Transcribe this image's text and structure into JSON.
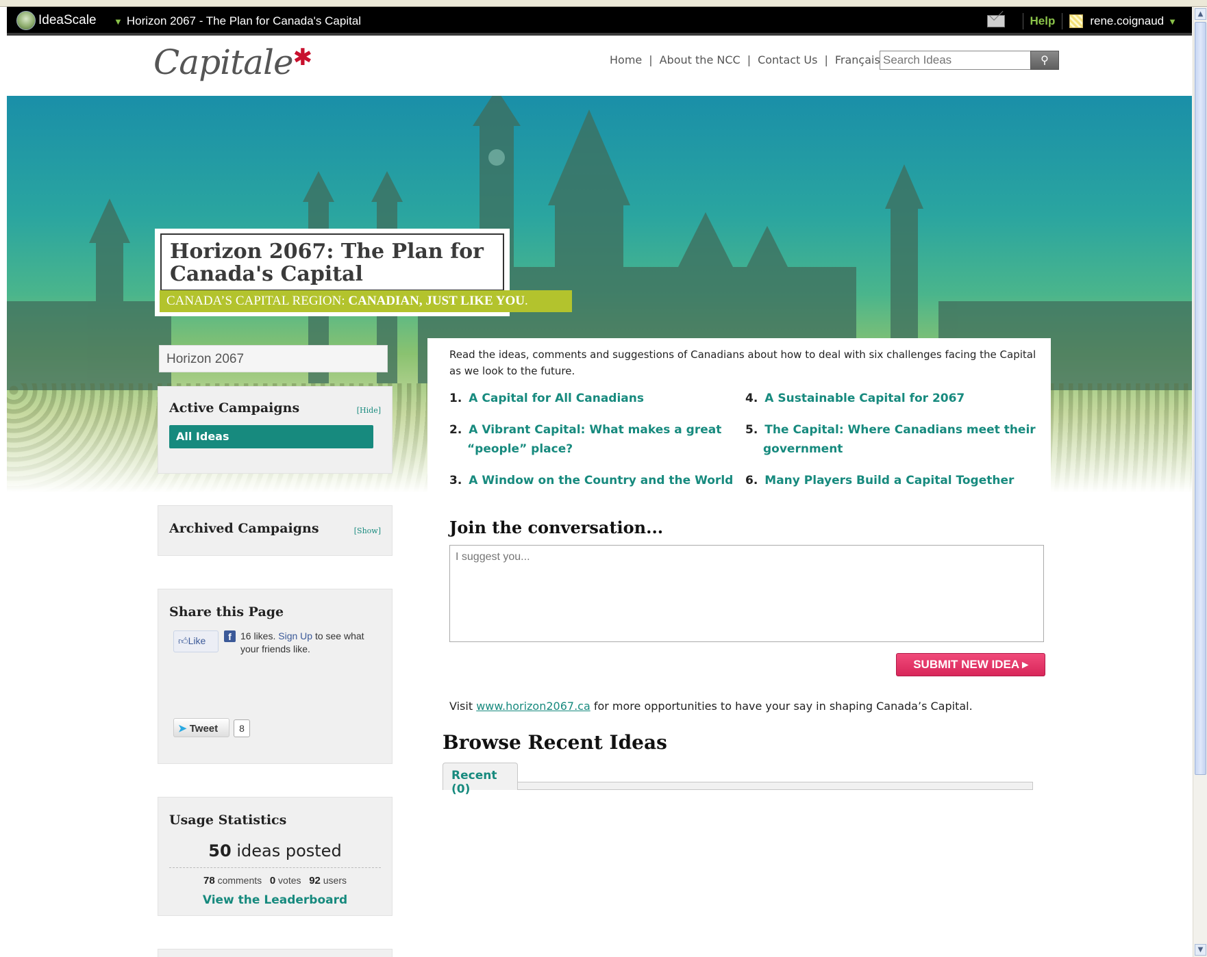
{
  "ideascale_bar": {
    "logo_text": "IdeaScale",
    "campaign_title": "Horizon 2067 - The Plan for Canada's Capital",
    "help_label": "Help",
    "username": "rene.coignaud",
    "dropdown_arrow": "▼"
  },
  "header": {
    "brand_text": "Capitale",
    "nav": [
      "Home",
      "About the NCC",
      "Contact Us",
      "Français"
    ],
    "nav_separator": "|",
    "search_placeholder": "Search Ideas"
  },
  "hero": {
    "title": "Horizon 2067: The Plan for Canada's Capital",
    "tagline_regular": "CANADA’S CAPITAL REGION: ",
    "tagline_bold": "CANADIAN, JUST LIKE YOU",
    "tagline_end": "."
  },
  "sidebar": {
    "breadcrumb": "Horizon 2067",
    "active": {
      "heading": "Active Campaigns",
      "toggle": "[Hide]",
      "item": "All Ideas"
    },
    "archived": {
      "heading": "Archived Campaigns",
      "toggle": "[Show]"
    },
    "share": {
      "heading": "Share this Page",
      "like_label": "Like",
      "likes_count_text": "16 likes.",
      "sign_up": "Sign Up",
      "like_rest": "to see what your friends like.",
      "tweet_label": "Tweet",
      "tweet_count": "8"
    },
    "stats": {
      "heading": "Usage Statistics",
      "ideas_count": "50",
      "ideas_label": "ideas posted",
      "comments_count": "78",
      "comments_label": "comments",
      "votes_count": "0",
      "votes_label": "votes",
      "users_count": "92",
      "users_label": "users",
      "leaderboard_link": "View the Leaderboard"
    }
  },
  "main": {
    "intro": "Read the ideas, comments and suggestions of Canadians about how to deal with six challenges facing the Capital as we look to the future.",
    "challenges": [
      {
        "num": "1.",
        "label": "A Capital for All Canadians"
      },
      {
        "num": "2.",
        "label_line1": "A Vibrant Capital: What makes a great",
        "label_line2": "“people” place?"
      },
      {
        "num": "3.",
        "label": "A Window on the Country and the World"
      },
      {
        "num": "4.",
        "label": "A Sustainable Capital for 2067"
      },
      {
        "num": "5.",
        "label_line1": "The Capital: Where Canadians meet their",
        "label_line2": "government"
      },
      {
        "num": "6.",
        "label": "Many Players Build a Capital Together"
      }
    ],
    "join_heading": "Join the conversation...",
    "idea_placeholder": "I suggest you...",
    "submit_label": "SUBMIT NEW IDEA",
    "visit_prefix": "Visit",
    "visit_url": "www.horizon2067.ca",
    "visit_suffix": "for more opportunities to have your say in shaping Canada’s Capital.",
    "browse_heading": "Browse Recent Ideas",
    "recent_tab": "Recent (0)"
  },
  "colors": {
    "accent_teal": "#178a7e",
    "tagline_green": "#b3c32d",
    "submit_pink": "#e23a6c",
    "bar_black": "#000000"
  },
  "icons": [
    "ideascale-logo-icon",
    "mail-icon",
    "avatar-icon",
    "search-icon",
    "maple-leaf-icon",
    "thumbs-up-icon",
    "facebook-icon",
    "twitter-bird-icon",
    "arrow-right-icon"
  ]
}
